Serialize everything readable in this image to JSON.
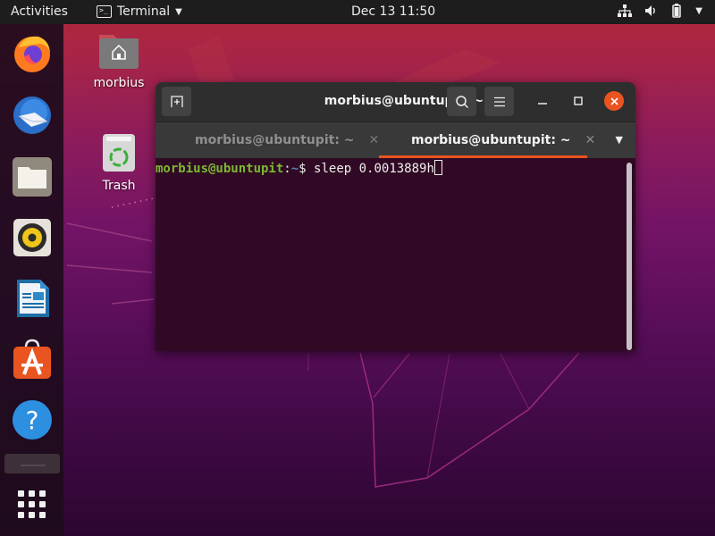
{
  "topbar": {
    "activities_label": "Activities",
    "app_menu_label": "Terminal",
    "app_menu_icon": "terminal-icon",
    "clock": "Dec 13  11:50",
    "tray_icons": [
      "network-icon",
      "volume-icon",
      "battery-icon",
      "system-menu-caret-icon"
    ]
  },
  "dock": {
    "items": [
      {
        "name": "Firefox",
        "icon": "firefox-icon"
      },
      {
        "name": "Thunderbird",
        "icon": "thunderbird-icon"
      },
      {
        "name": "Files",
        "icon": "files-icon"
      },
      {
        "name": "Rhythmbox",
        "icon": "rhythmbox-icon"
      },
      {
        "name": "LibreOffice Writer",
        "icon": "writer-icon"
      },
      {
        "name": "Ubuntu Software",
        "icon": "software-icon"
      },
      {
        "name": "Help",
        "icon": "help-icon"
      }
    ],
    "show_apps_icon": "show-applications-icon"
  },
  "desktop": {
    "icons": [
      {
        "label": "morbius",
        "icon": "home-folder-icon"
      },
      {
        "label": "Trash",
        "icon": "trash-icon"
      }
    ]
  },
  "terminal": {
    "title": "morbius@ubuntupit: ~",
    "tabs": [
      {
        "label": "morbius@ubuntupit: ~",
        "active": false
      },
      {
        "label": "morbius@ubuntupit: ~",
        "active": true
      }
    ],
    "tab_close_glyph": "✕",
    "prompt": {
      "user_host": "morbius@ubuntupit",
      "separator": ":",
      "path": "~",
      "symbol": "$ ",
      "command": "sleep 0.0013889h"
    }
  },
  "colors": {
    "accent": "#e95420",
    "terminal_bg": "#300a24",
    "prompt_user": "#7cb832",
    "prompt_path": "#5d7fb5"
  }
}
